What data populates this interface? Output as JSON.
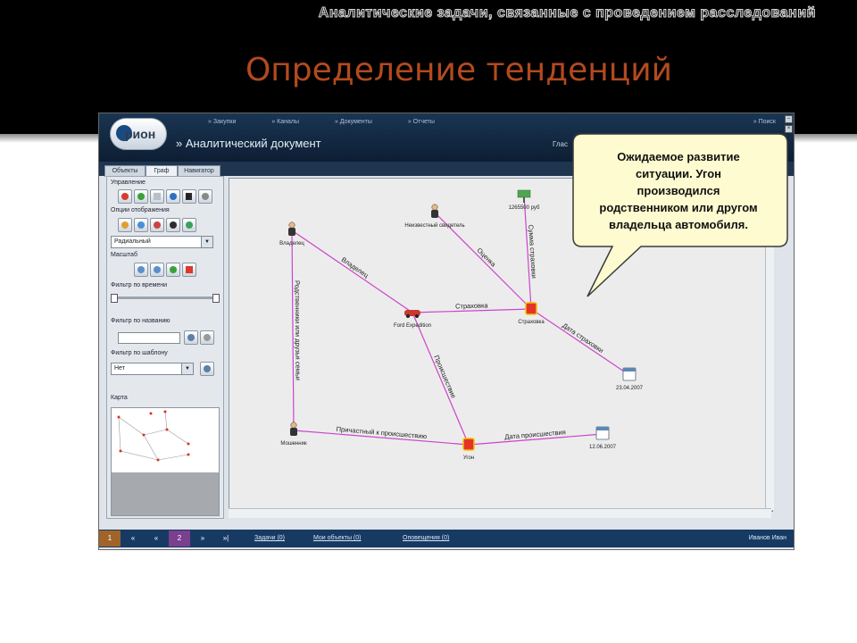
{
  "slide": {
    "section_title": "Аналитические задачи, связанные с проведением расследований",
    "title": "Определение тенденций"
  },
  "app": {
    "logo_text": "рион",
    "top_nav": [
      "» Закупки",
      "» Каналы",
      "» Документы",
      "» Отчеты"
    ],
    "top_nav_right": "» Поиск",
    "document_title": "» Аналитический документ",
    "document_right": "Глас",
    "tabs": [
      "Объекты",
      "Граф",
      "Навигатор"
    ],
    "left_panel": {
      "control_label": "Управление",
      "display_label": "Опции отображения",
      "layout_select": "Радиальный",
      "scale_label": "Масштаб",
      "time_filter_label": "Фильтр по времени",
      "name_filter_label": "Фильтр по названию",
      "template_filter_label": "Фильтр по шаблону",
      "template_select": "Нет",
      "map_label": "Карта"
    },
    "bottom_bar": {
      "page_buttons": [
        "1",
        "«",
        "«",
        "2",
        "»",
        "»|"
      ],
      "links": [
        "Задачи (0)",
        "Мои объекты (0)",
        "Оповещения (0)"
      ],
      "user": "Иванов Иван"
    }
  },
  "graph": {
    "nodes": [
      {
        "id": "applicant",
        "label": "Владелец",
        "icon": "person-icon"
      },
      {
        "id": "unknown",
        "label": "Неизвестный свидетель",
        "icon": "person-icon"
      },
      {
        "id": "money",
        "label": "1265500 руб",
        "icon": "money-icon"
      },
      {
        "id": "car",
        "label": "Ford Expedition",
        "icon": "car-icon"
      },
      {
        "id": "insurance",
        "label": "Страховка",
        "icon": "event-icon"
      },
      {
        "id": "date1",
        "label": "23.04.2007",
        "icon": "calendar-icon"
      },
      {
        "id": "fraudster",
        "label": "Мошенник",
        "icon": "person-icon"
      },
      {
        "id": "theft",
        "label": "Угон",
        "icon": "event-icon"
      },
      {
        "id": "date2",
        "label": "12.06.2007",
        "icon": "calendar-icon"
      }
    ],
    "edges": [
      {
        "from": "applicant",
        "to": "car",
        "label": "Владелец"
      },
      {
        "from": "applicant",
        "to": "fraudster",
        "label": "Родственники или друзья семьи"
      },
      {
        "from": "car",
        "to": "insurance",
        "label": "Страховка"
      },
      {
        "from": "unknown",
        "to": "insurance",
        "label": "Оценка"
      },
      {
        "from": "money",
        "to": "insurance",
        "label": "Сумма страховки"
      },
      {
        "from": "insurance",
        "to": "date1",
        "label": "Дата страховки"
      },
      {
        "from": "car",
        "to": "theft",
        "label": "Происшествие"
      },
      {
        "from": "fraudster",
        "to": "theft",
        "label": "Причастный к происшествию"
      },
      {
        "from": "theft",
        "to": "date2",
        "label": "Дата происшествия"
      }
    ]
  },
  "callout": {
    "text": "Ожидаемое развитие\nситуации. Угон\nпроизводился\nродственником или другом\nвладельца автомобиля."
  },
  "colors": {
    "title": "#b24a1e",
    "edge": "#cc44cc",
    "callout_fill": "#fffbd0",
    "header": "#1a3552"
  }
}
